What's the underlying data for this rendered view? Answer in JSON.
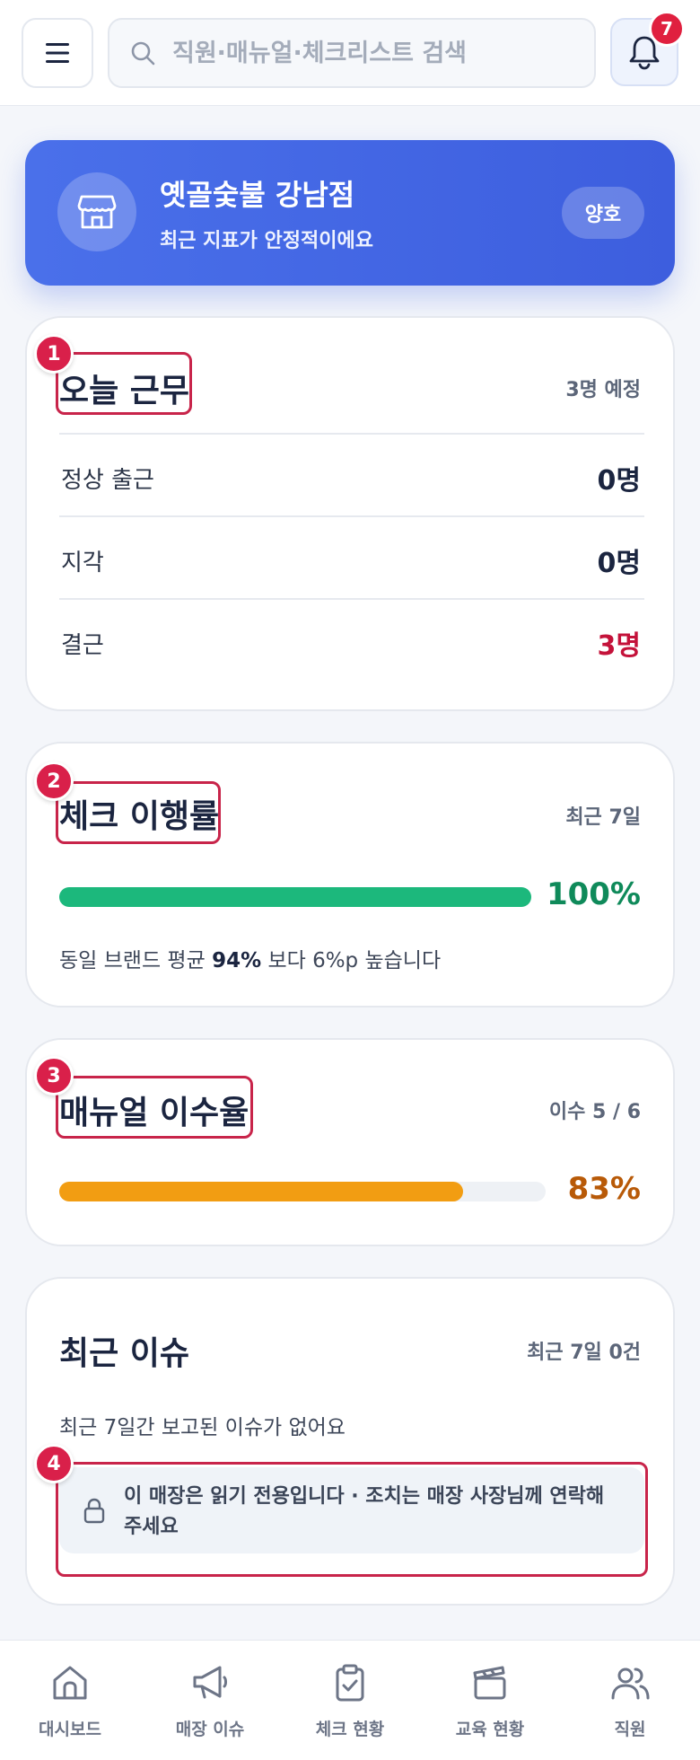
{
  "header": {
    "search_placeholder": "직원·매뉴얼·체크리스트 검색",
    "notification_count": "7"
  },
  "store": {
    "name": "옛골숯불 강남점",
    "subtitle": "최근 지표가 안정적이에요",
    "status": "양호"
  },
  "today_work": {
    "marker": "1",
    "title": "오늘 근무",
    "scheduled": "3명 예정",
    "rows": [
      {
        "label": "정상 출근",
        "value": "0명"
      },
      {
        "label": "지각",
        "value": "0명"
      },
      {
        "label": "결근",
        "value": "3명"
      }
    ]
  },
  "check_rate": {
    "marker": "2",
    "title": "체크 이행률",
    "period": "최근 7일",
    "percent_text": "100%",
    "progress": 1.0,
    "note_prefix": "동일 브랜드 평균",
    "note_bold": "94%",
    "note_suffix": "보다 6%p 높습니다",
    "color": "#1cb87c"
  },
  "manual_rate": {
    "marker": "3",
    "title": "매뉴얼 이수율",
    "count": "이수 5 / 6",
    "percent_text": "83%",
    "progress": 0.83,
    "color": "#f29d12"
  },
  "recent_issues": {
    "title": "최근 이슈",
    "summary": "최근 7일 0건",
    "empty_text": "최근 7일간 보고된 이슈가 없어요",
    "marker": "4",
    "readonly_notice": "이 매장은 읽기 전용입니다 · 조치는 매장 사장님께 연락해 주세요"
  },
  "bottom_nav": [
    {
      "label": "대시보드",
      "icon": "home-icon"
    },
    {
      "label": "매장 이슈",
      "icon": "megaphone-icon"
    },
    {
      "label": "체크 현황",
      "icon": "clipboard-check-icon"
    },
    {
      "label": "교육 현황",
      "icon": "clapperboard-icon"
    },
    {
      "label": "직원",
      "icon": "users-icon"
    }
  ]
}
